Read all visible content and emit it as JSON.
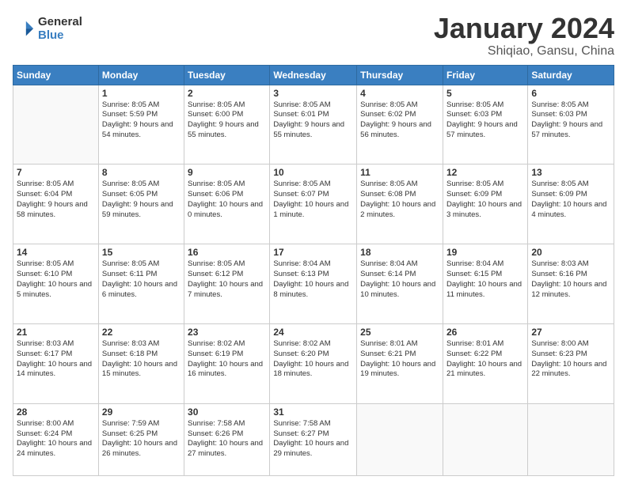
{
  "header": {
    "logo": {
      "general": "General",
      "blue": "Blue"
    },
    "title": "January 2024",
    "subtitle": "Shiqiao, Gansu, China"
  },
  "days_of_week": [
    "Sunday",
    "Monday",
    "Tuesday",
    "Wednesday",
    "Thursday",
    "Friday",
    "Saturday"
  ],
  "weeks": [
    [
      {
        "day": "",
        "sunrise": "",
        "sunset": "",
        "daylight": ""
      },
      {
        "day": "1",
        "sunrise": "Sunrise: 8:05 AM",
        "sunset": "Sunset: 5:59 PM",
        "daylight": "Daylight: 9 hours and 54 minutes."
      },
      {
        "day": "2",
        "sunrise": "Sunrise: 8:05 AM",
        "sunset": "Sunset: 6:00 PM",
        "daylight": "Daylight: 9 hours and 55 minutes."
      },
      {
        "day": "3",
        "sunrise": "Sunrise: 8:05 AM",
        "sunset": "Sunset: 6:01 PM",
        "daylight": "Daylight: 9 hours and 55 minutes."
      },
      {
        "day": "4",
        "sunrise": "Sunrise: 8:05 AM",
        "sunset": "Sunset: 6:02 PM",
        "daylight": "Daylight: 9 hours and 56 minutes."
      },
      {
        "day": "5",
        "sunrise": "Sunrise: 8:05 AM",
        "sunset": "Sunset: 6:03 PM",
        "daylight": "Daylight: 9 hours and 57 minutes."
      },
      {
        "day": "6",
        "sunrise": "Sunrise: 8:05 AM",
        "sunset": "Sunset: 6:03 PM",
        "daylight": "Daylight: 9 hours and 57 minutes."
      }
    ],
    [
      {
        "day": "7",
        "sunrise": "Sunrise: 8:05 AM",
        "sunset": "Sunset: 6:04 PM",
        "daylight": "Daylight: 9 hours and 58 minutes."
      },
      {
        "day": "8",
        "sunrise": "Sunrise: 8:05 AM",
        "sunset": "Sunset: 6:05 PM",
        "daylight": "Daylight: 9 hours and 59 minutes."
      },
      {
        "day": "9",
        "sunrise": "Sunrise: 8:05 AM",
        "sunset": "Sunset: 6:06 PM",
        "daylight": "Daylight: 10 hours and 0 minutes."
      },
      {
        "day": "10",
        "sunrise": "Sunrise: 8:05 AM",
        "sunset": "Sunset: 6:07 PM",
        "daylight": "Daylight: 10 hours and 1 minute."
      },
      {
        "day": "11",
        "sunrise": "Sunrise: 8:05 AM",
        "sunset": "Sunset: 6:08 PM",
        "daylight": "Daylight: 10 hours and 2 minutes."
      },
      {
        "day": "12",
        "sunrise": "Sunrise: 8:05 AM",
        "sunset": "Sunset: 6:09 PM",
        "daylight": "Daylight: 10 hours and 3 minutes."
      },
      {
        "day": "13",
        "sunrise": "Sunrise: 8:05 AM",
        "sunset": "Sunset: 6:09 PM",
        "daylight": "Daylight: 10 hours and 4 minutes."
      }
    ],
    [
      {
        "day": "14",
        "sunrise": "Sunrise: 8:05 AM",
        "sunset": "Sunset: 6:10 PM",
        "daylight": "Daylight: 10 hours and 5 minutes."
      },
      {
        "day": "15",
        "sunrise": "Sunrise: 8:05 AM",
        "sunset": "Sunset: 6:11 PM",
        "daylight": "Daylight: 10 hours and 6 minutes."
      },
      {
        "day": "16",
        "sunrise": "Sunrise: 8:05 AM",
        "sunset": "Sunset: 6:12 PM",
        "daylight": "Daylight: 10 hours and 7 minutes."
      },
      {
        "day": "17",
        "sunrise": "Sunrise: 8:04 AM",
        "sunset": "Sunset: 6:13 PM",
        "daylight": "Daylight: 10 hours and 8 minutes."
      },
      {
        "day": "18",
        "sunrise": "Sunrise: 8:04 AM",
        "sunset": "Sunset: 6:14 PM",
        "daylight": "Daylight: 10 hours and 10 minutes."
      },
      {
        "day": "19",
        "sunrise": "Sunrise: 8:04 AM",
        "sunset": "Sunset: 6:15 PM",
        "daylight": "Daylight: 10 hours and 11 minutes."
      },
      {
        "day": "20",
        "sunrise": "Sunrise: 8:03 AM",
        "sunset": "Sunset: 6:16 PM",
        "daylight": "Daylight: 10 hours and 12 minutes."
      }
    ],
    [
      {
        "day": "21",
        "sunrise": "Sunrise: 8:03 AM",
        "sunset": "Sunset: 6:17 PM",
        "daylight": "Daylight: 10 hours and 14 minutes."
      },
      {
        "day": "22",
        "sunrise": "Sunrise: 8:03 AM",
        "sunset": "Sunset: 6:18 PM",
        "daylight": "Daylight: 10 hours and 15 minutes."
      },
      {
        "day": "23",
        "sunrise": "Sunrise: 8:02 AM",
        "sunset": "Sunset: 6:19 PM",
        "daylight": "Daylight: 10 hours and 16 minutes."
      },
      {
        "day": "24",
        "sunrise": "Sunrise: 8:02 AM",
        "sunset": "Sunset: 6:20 PM",
        "daylight": "Daylight: 10 hours and 18 minutes."
      },
      {
        "day": "25",
        "sunrise": "Sunrise: 8:01 AM",
        "sunset": "Sunset: 6:21 PM",
        "daylight": "Daylight: 10 hours and 19 minutes."
      },
      {
        "day": "26",
        "sunrise": "Sunrise: 8:01 AM",
        "sunset": "Sunset: 6:22 PM",
        "daylight": "Daylight: 10 hours and 21 minutes."
      },
      {
        "day": "27",
        "sunrise": "Sunrise: 8:00 AM",
        "sunset": "Sunset: 6:23 PM",
        "daylight": "Daylight: 10 hours and 22 minutes."
      }
    ],
    [
      {
        "day": "28",
        "sunrise": "Sunrise: 8:00 AM",
        "sunset": "Sunset: 6:24 PM",
        "daylight": "Daylight: 10 hours and 24 minutes."
      },
      {
        "day": "29",
        "sunrise": "Sunrise: 7:59 AM",
        "sunset": "Sunset: 6:25 PM",
        "daylight": "Daylight: 10 hours and 26 minutes."
      },
      {
        "day": "30",
        "sunrise": "Sunrise: 7:58 AM",
        "sunset": "Sunset: 6:26 PM",
        "daylight": "Daylight: 10 hours and 27 minutes."
      },
      {
        "day": "31",
        "sunrise": "Sunrise: 7:58 AM",
        "sunset": "Sunset: 6:27 PM",
        "daylight": "Daylight: 10 hours and 29 minutes."
      },
      {
        "day": "",
        "sunrise": "",
        "sunset": "",
        "daylight": ""
      },
      {
        "day": "",
        "sunrise": "",
        "sunset": "",
        "daylight": ""
      },
      {
        "day": "",
        "sunrise": "",
        "sunset": "",
        "daylight": ""
      }
    ]
  ]
}
